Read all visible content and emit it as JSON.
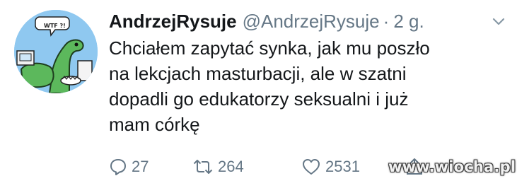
{
  "author": {
    "display_name": "AndrzejRysuje",
    "handle": "@AndrzejRysuje",
    "separator": "·",
    "time": "2 g.",
    "avatar_caption": "WTF ?!"
  },
  "tweet": {
    "text": "Chciałem zapytać synka, jak mu poszło\nna lekcjach masturbacji, ale w szatni\ndopadli go edukatorzy seksualni i już\nmam córkę"
  },
  "actions": {
    "reply_count": "27",
    "retweet_count": "264",
    "like_count": "2531"
  },
  "watermark": "www.wiocha.pl",
  "colors": {
    "text": "#14171a",
    "secondary": "#657786",
    "avatar_bg": "#8fc8f0",
    "dino": "#5cb85c"
  },
  "icons": {
    "reply": "reply-icon",
    "retweet": "retweet-icon",
    "like": "heart-icon",
    "share": "share-icon",
    "menu": "chevron-down-icon"
  }
}
